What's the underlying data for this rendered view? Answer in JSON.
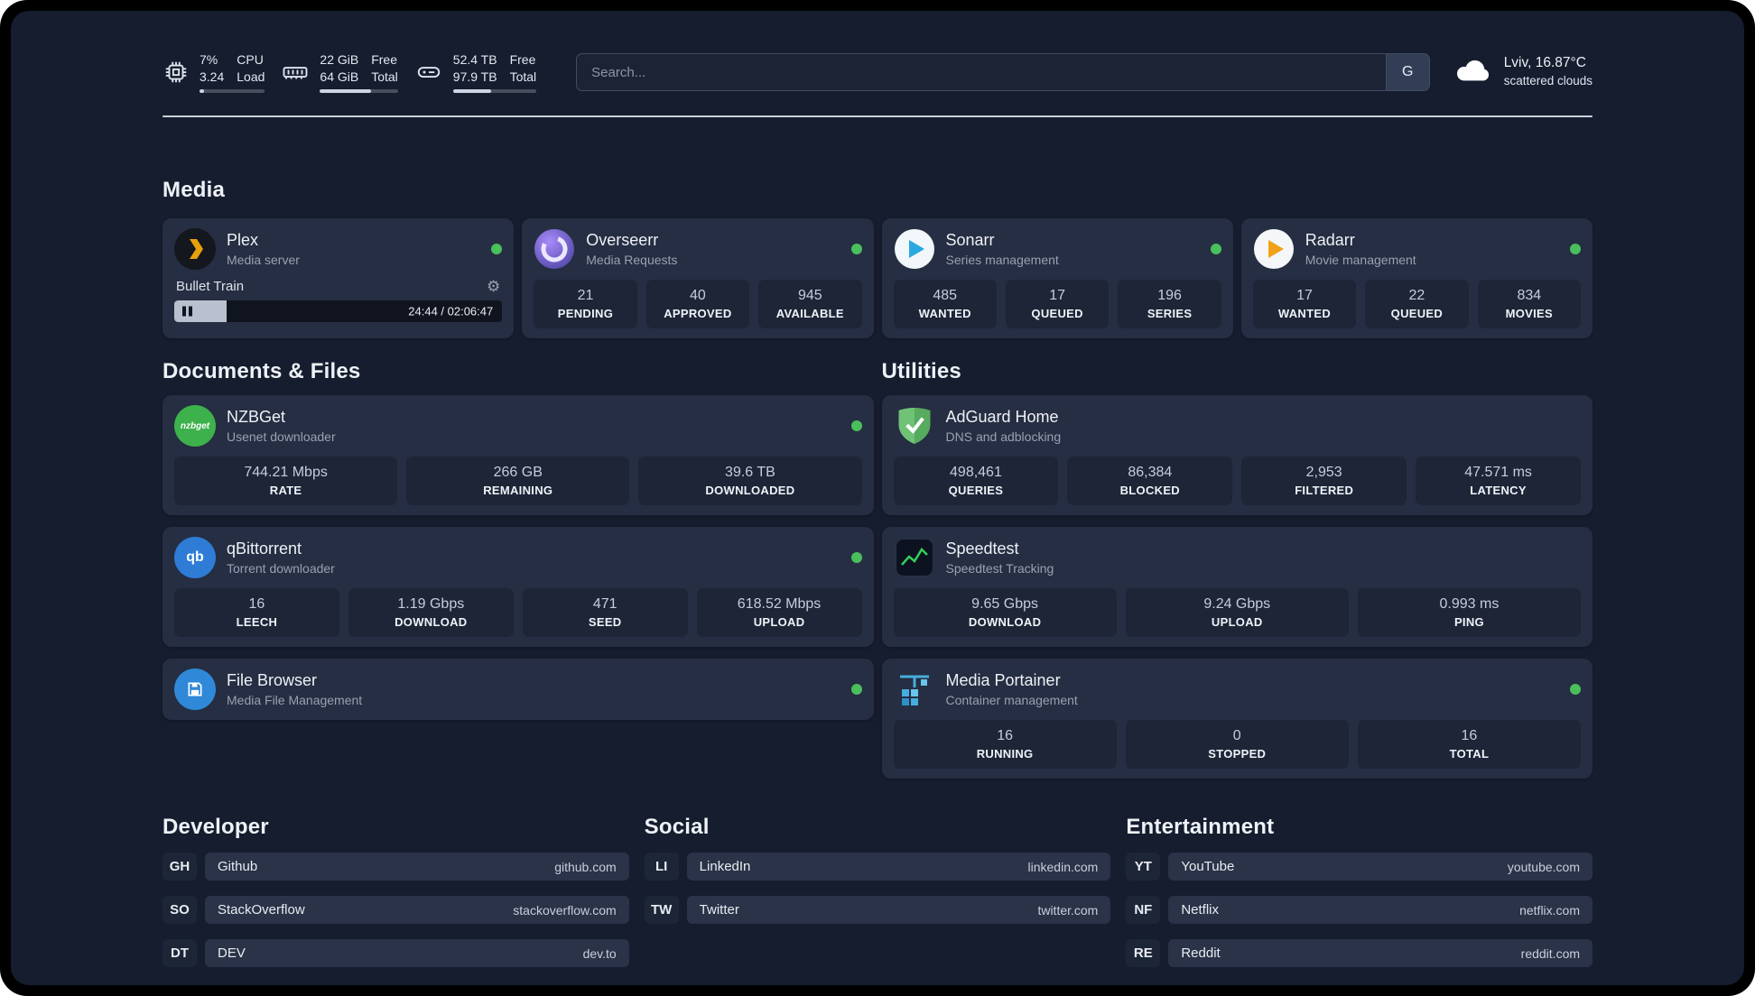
{
  "topbar": {
    "monitors": [
      {
        "v1": "7%",
        "v2": "3.24",
        "l1": "CPU",
        "l2": "Load",
        "pct": 7
      },
      {
        "v1": "22 GiB",
        "v2": "64 GiB",
        "l1": "Free",
        "l2": "Total",
        "pct": 66
      },
      {
        "v1": "52.4 TB",
        "v2": "97.9 TB",
        "l1": "Free",
        "l2": "Total",
        "pct": 46
      }
    ],
    "search": {
      "placeholder": "Search...",
      "button_label": "G"
    },
    "weather": {
      "location": "Lviv, 16.87°C",
      "condition": "scattered clouds"
    }
  },
  "sections": {
    "media": "Media",
    "documents": "Documents & Files",
    "utilities": "Utilities",
    "developer": "Developer",
    "social": "Social",
    "entertainment": "Entertainment"
  },
  "cards": {
    "plex": {
      "name": "Plex",
      "subtitle": "Media server",
      "player": {
        "title": "Bullet Train",
        "time": "24:44 / 02:06:47",
        "progress_pct": 16
      }
    },
    "overseerr": {
      "name": "Overseerr",
      "subtitle": "Media Requests",
      "stats": [
        {
          "value": "21",
          "label": "PENDING"
        },
        {
          "value": "40",
          "label": "APPROVED"
        },
        {
          "value": "945",
          "label": "AVAILABLE"
        }
      ]
    },
    "sonarr": {
      "name": "Sonarr",
      "subtitle": "Series management",
      "stats": [
        {
          "value": "485",
          "label": "WANTED"
        },
        {
          "value": "17",
          "label": "QUEUED"
        },
        {
          "value": "196",
          "label": "SERIES"
        }
      ]
    },
    "radarr": {
      "name": "Radarr",
      "subtitle": "Movie management",
      "stats": [
        {
          "value": "17",
          "label": "WANTED"
        },
        {
          "value": "22",
          "label": "QUEUED"
        },
        {
          "value": "834",
          "label": "MOVIES"
        }
      ]
    },
    "nzbget": {
      "name": "NZBGet",
      "subtitle": "Usenet downloader",
      "icon_text": "nzbget",
      "stats": [
        {
          "value": "744.21 Mbps",
          "label": "RATE"
        },
        {
          "value": "266 GB",
          "label": "REMAINING"
        },
        {
          "value": "39.6 TB",
          "label": "DOWNLOADED"
        }
      ]
    },
    "qbittorrent": {
      "name": "qBittorrent",
      "subtitle": "Torrent downloader",
      "icon_text": "qb",
      "stats": [
        {
          "value": "16",
          "label": "LEECH"
        },
        {
          "value": "1.19 Gbps",
          "label": "DOWNLOAD"
        },
        {
          "value": "471",
          "label": "SEED"
        },
        {
          "value": "618.52 Mbps",
          "label": "UPLOAD"
        }
      ]
    },
    "filebrowser": {
      "name": "File Browser",
      "subtitle": "Media File Management"
    },
    "adguard": {
      "name": "AdGuard Home",
      "subtitle": "DNS and adblocking",
      "stats": [
        {
          "value": "498,461",
          "label": "QUERIES"
        },
        {
          "value": "86,384",
          "label": "BLOCKED"
        },
        {
          "value": "2,953",
          "label": "FILTERED"
        },
        {
          "value": "47.571 ms",
          "label": "LATENCY"
        }
      ]
    },
    "speedtest": {
      "name": "Speedtest",
      "subtitle": "Speedtest Tracking",
      "stats": [
        {
          "value": "9.65 Gbps",
          "label": "DOWNLOAD"
        },
        {
          "value": "9.24 Gbps",
          "label": "UPLOAD"
        },
        {
          "value": "0.993 ms",
          "label": "PING"
        }
      ]
    },
    "portainer": {
      "name": "Media Portainer",
      "subtitle": "Container management",
      "stats": [
        {
          "value": "16",
          "label": "RUNNING"
        },
        {
          "value": "0",
          "label": "STOPPED"
        },
        {
          "value": "16",
          "label": "TOTAL"
        }
      ]
    }
  },
  "links": {
    "developer": [
      {
        "badge": "GH",
        "name": "Github",
        "url": "github.com"
      },
      {
        "badge": "SO",
        "name": "StackOverflow",
        "url": "stackoverflow.com"
      },
      {
        "badge": "DT",
        "name": "DEV",
        "url": "dev.to"
      }
    ],
    "social": [
      {
        "badge": "LI",
        "name": "LinkedIn",
        "url": "linkedin.com"
      },
      {
        "badge": "TW",
        "name": "Twitter",
        "url": "twitter.com"
      }
    ],
    "entertainment": [
      {
        "badge": "YT",
        "name": "YouTube",
        "url": "youtube.com"
      },
      {
        "badge": "NF",
        "name": "Netflix",
        "url": "netflix.com"
      },
      {
        "badge": "RE",
        "name": "Reddit",
        "url": "reddit.com"
      }
    ]
  },
  "colors": {
    "accent_green": "#4abf5c",
    "background": "#161d2f",
    "card": "#252e42"
  }
}
